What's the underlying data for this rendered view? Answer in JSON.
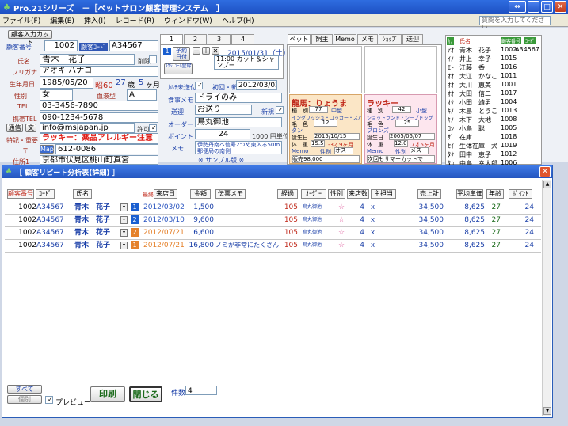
{
  "window": {
    "title": "Pro.21シリーズ　－［ペットサロン顧客管理システム　］"
  },
  "menu": [
    "ファイル(F)",
    "編集(E)",
    "挿入(I)",
    "レコード(R)",
    "ウィンドウ(W)",
    "ヘルプ(H)"
  ],
  "question_placeholder": "質問を入力してください",
  "customer": {
    "lookup_label": "顧客入力カット",
    "id_label": "顧客番号",
    "id": "1002",
    "code_label": "顧客ｺｰﾄﾞ",
    "code": "A34567",
    "name_label": "氏名",
    "name": "青木　花子",
    "deleted_label": "削除",
    "kana_label": "フリガナ",
    "kana": "アオキ ハナコ",
    "birth_label": "生年月日",
    "birth": "1985/05/20",
    "era": "昭60",
    "age": "27",
    "age_unit": "歳",
    "months": "5",
    "months_unit": "ヶ月",
    "gender_label": "性別",
    "gender": "女",
    "blood_label": "血液型",
    "blood": "A",
    "tel_label": "TEL",
    "tel": "03-3456-7890",
    "mobile_label": "携帯TEL",
    "mobile": "090-1234-5678",
    "mail_btn": "通信",
    "text_btn": "文",
    "email": "info@msjapan.jp",
    "permit_label": "許可",
    "note_label": "特記・重要",
    "note": "ラッキー：薬品アレルギー注意",
    "zip_label": "〒",
    "map_btn": "Map",
    "zip": "612-0086",
    "addr_label": "住所1",
    "addr": "京都市伏見区桃山町真宮"
  },
  "visit_tabs": [
    "1",
    "2",
    "3",
    "4"
  ],
  "visit": {
    "num": "1",
    "reserve_btn": "予約日付",
    "date": "2015/01/31（土）",
    "course": "11:00 カット＆シャンプー",
    "schedule_btn": "ｽｹｼﾞｭｰﾙ登録"
  },
  "visit_fields": {
    "card_label": "ｶﾙﾃ未送付",
    "first_label": "初回・新規",
    "first_date": "2012/03/02",
    "meal_label": "食事メモ",
    "meal": "ドライのみ",
    "pickup_label": "送迎",
    "pickup": "お送り",
    "new_label": "新規",
    "order_label": "オーダー",
    "order": "鳥丸御池",
    "point_label": "ポイント",
    "point": "24",
    "point_unit": "1000 円単位",
    "memo_label": "メモ",
    "memo": "伊勢丹南ヘ信号2つめ東入る50m郵便局の南側",
    "sample": "※ サンプル版 ※"
  },
  "pet_tabs": [
    "ペット",
    "飼主",
    "Memo",
    "メモ",
    "ｼｮｯﾌﾟ",
    "送迎"
  ],
  "pets": [
    {
      "name": "龍馬：りょうま",
      "type_label": "種　別",
      "type": "77",
      "size": "中型",
      "breed": "イングリッシュ・コッカー・スパニエル",
      "color_label": "毛　色",
      "color": "12",
      "color_name": "タン",
      "birth_label": "誕生日",
      "birth": "2015/10/15",
      "weight_label": "体　重",
      "weight": "15.5",
      "age": "-3才9ヶ月",
      "memo_label": "Memo",
      "sex_label": "性別",
      "sex": "オス",
      "memo_text": "販売98,000"
    },
    {
      "name": "ラッキー",
      "type_label": "種　別",
      "type": "42",
      "size": "小型",
      "breed": "ショットランド・シープドッグ",
      "color_label": "毛　色",
      "color": "25",
      "color_name": "ブロンズ",
      "birth_label": "誕生日",
      "birth": "2005/05/07",
      "weight_label": "体　重",
      "weight": "12.0",
      "age": "7才5ヶ月",
      "memo_label": "Memo",
      "sex_label": "性別",
      "sex": "メス",
      "memo_text": "次回もサマーカットで"
    }
  ],
  "side_list": {
    "headers": [
      "ｶﾅ",
      "氏名",
      "顧客番号",
      "ｺｰﾄﾞ"
    ],
    "rows": [
      [
        "ｱｵ",
        "青木　花子",
        "1002",
        "A34567"
      ],
      [
        "ｲﾉ",
        "井上　幸子",
        "1015",
        ""
      ],
      [
        "ｴﾄ",
        "江藤　香",
        "1016",
        ""
      ],
      [
        "ｵｵ",
        "大江　かなこ",
        "1011",
        ""
      ],
      [
        "ｵｵ",
        "大川　恵美",
        "1001",
        ""
      ],
      [
        "ｵｵ",
        "大田　信二",
        "1017",
        ""
      ],
      [
        "ｵｸ",
        "小田　靖男",
        "1004",
        ""
      ],
      [
        "ｷﾉ",
        "木島　とうこ",
        "1013",
        ""
      ],
      [
        "ｷﾉ",
        "木下　大地",
        "1008",
        ""
      ],
      [
        "ｺｼ",
        "小島　聡",
        "1005",
        ""
      ],
      [
        "ｻﾞ",
        "在庫",
        "1018",
        ""
      ],
      [
        "ｾｲ",
        "生体在庫　犬",
        "1019",
        ""
      ],
      [
        "ﾀｸ",
        "田中　恵子",
        "1012",
        ""
      ],
      [
        "ﾀｶ",
        "中島　幸太郎",
        "1006",
        ""
      ]
    ]
  },
  "report": {
    "title": "［ 顧客リピート分析表(詳細) ］",
    "headers": {
      "id": "顧客番号",
      "code": "ｺｰﾄﾞ",
      "name": "氏名",
      "latest": "最終",
      "visit": "来店日",
      "amount": "金額",
      "course": "伝票メモ",
      "elapsed": "経過",
      "order": "ｵｰﾀﾞｰ",
      "gender": "性別",
      "visits": "来店数",
      "staff": "主担当",
      "sales": "売上計",
      "avg": "平均単価",
      "age": "年齢",
      "point": "ﾎﾟｲﾝﾄ"
    },
    "rows": [
      {
        "id": "1002",
        "code": "A34567",
        "name": "青木　花子",
        "num": "1",
        "date": "2012/03/02",
        "amount": "1,500",
        "memo": "",
        "elapsed": "105",
        "order": "烏丸御池",
        "star": "☆",
        "visits": "4",
        "staff": "ｘ",
        "sales": "34,500",
        "avg": "8,625",
        "age": "27",
        "point": "24",
        "num_color": "#1a5fd0",
        "date_color": "#2a55c0"
      },
      {
        "id": "1002",
        "code": "A34567",
        "name": "青木　花子",
        "num": "2",
        "date": "2012/03/10",
        "amount": "9,600",
        "memo": "",
        "elapsed": "105",
        "order": "烏丸御池",
        "star": "☆",
        "visits": "4",
        "staff": "ｘ",
        "sales": "34,500",
        "avg": "8,625",
        "age": "27",
        "point": "24",
        "num_color": "#1a5fd0",
        "date_color": "#2a55c0"
      },
      {
        "id": "1002",
        "code": "A34567",
        "name": "青木　花子",
        "num": "2",
        "date": "2012/07/21",
        "amount": "6,600",
        "memo": "",
        "elapsed": "105",
        "order": "烏丸御池",
        "star": "☆",
        "visits": "4",
        "staff": "ｘ",
        "sales": "34,500",
        "avg": "8,625",
        "age": "27",
        "point": "24",
        "num_color": "#e5812a",
        "date_color": "#e5812a"
      },
      {
        "id": "1002",
        "code": "A34567",
        "name": "青木　花子",
        "num": "1",
        "date": "2012/07/21",
        "amount": "16,800",
        "memo": "ノミが非常にたくさん発生",
        "elapsed": "105",
        "order": "烏丸御池",
        "star": "☆",
        "visits": "4",
        "staff": "ｘ",
        "sales": "34,500",
        "avg": "8,625",
        "age": "27",
        "point": "24",
        "num_color": "#e5812a",
        "date_color": "#e5812a"
      }
    ],
    "footer": {
      "all_btn": "すべて",
      "filter_btn": "個別",
      "preview_label": "プレビュー",
      "print_btn": "印刷",
      "close_btn": "閉じる",
      "count_label": "件数",
      "count": "4"
    }
  }
}
